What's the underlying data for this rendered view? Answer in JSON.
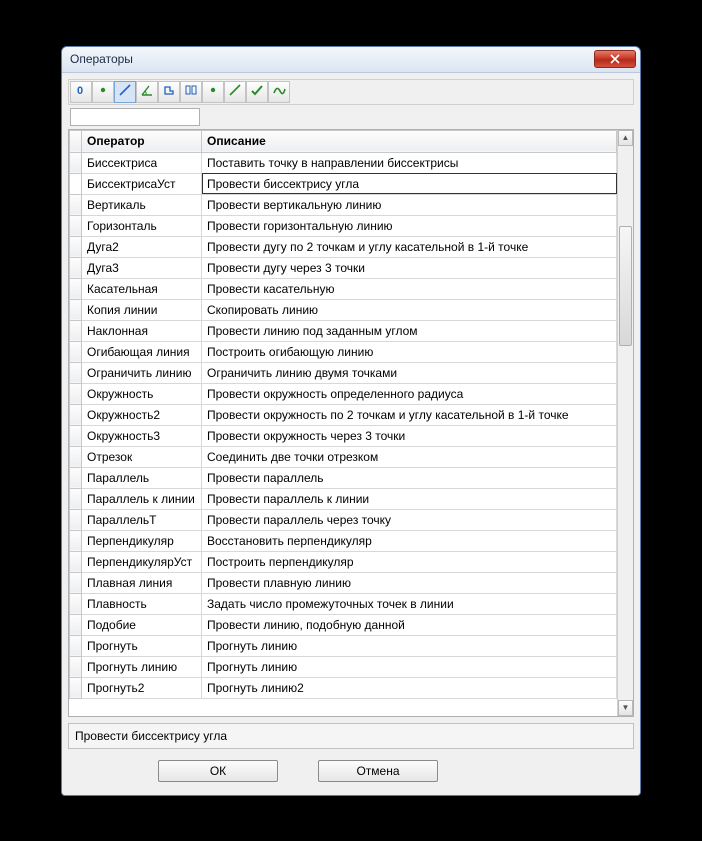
{
  "window": {
    "title": "Операторы"
  },
  "toolbar": {
    "items": [
      {
        "name": "tool-0",
        "icon": "zero"
      },
      {
        "name": "tool-dot",
        "icon": "dot"
      },
      {
        "name": "tool-line",
        "icon": "line",
        "active": true
      },
      {
        "name": "tool-angle",
        "icon": "angle"
      },
      {
        "name": "tool-poly",
        "icon": "poly"
      },
      {
        "name": "tool-align",
        "icon": "align"
      },
      {
        "name": "tool-dot2",
        "icon": "greendot"
      },
      {
        "name": "tool-line2",
        "icon": "line2"
      },
      {
        "name": "tool-check",
        "icon": "check"
      },
      {
        "name": "tool-curve",
        "icon": "curve"
      }
    ]
  },
  "search": {
    "value": ""
  },
  "columns": {
    "operator": "Оператор",
    "description": "Описание"
  },
  "rows": [
    {
      "op": "Биссектриса",
      "desc": "Поставить точку в направлении биссектрисы"
    },
    {
      "op": "БиссектрисаУст",
      "desc": "Провести биссектрису угла",
      "selected": true
    },
    {
      "op": "Вертикаль",
      "desc": "Провести вертикальную линию"
    },
    {
      "op": "Горизонталь",
      "desc": "Провести горизонтальную линию"
    },
    {
      "op": "Дуга2",
      "desc": "Провести дугу по 2 точкам и углу касательной в 1-й точке"
    },
    {
      "op": "Дуга3",
      "desc": "Провести дугу через 3 точки"
    },
    {
      "op": "Касательная",
      "desc": "Провести касательную"
    },
    {
      "op": "Копия линии",
      "desc": "Скопировать линию"
    },
    {
      "op": "Наклонная",
      "desc": "Провести линию под заданным углом"
    },
    {
      "op": "Огибающая линия",
      "desc": "Построить огибающую линию"
    },
    {
      "op": "Ограничить линию",
      "desc": "Ограничить линию двумя точками"
    },
    {
      "op": "Окружность",
      "desc": "Провести окружность определенного радиуса"
    },
    {
      "op": "Окружность2",
      "desc": "Провести окружность по 2 точкам и углу касательной в 1-й точке"
    },
    {
      "op": "Окружность3",
      "desc": "Провести окружность через 3 точки"
    },
    {
      "op": "Отрезок",
      "desc": "Соединить две точки отрезком"
    },
    {
      "op": "Параллель",
      "desc": "Провести параллель"
    },
    {
      "op": "Параллель к линии",
      "desc": "Провести параллель к линии"
    },
    {
      "op": "ПараллельТ",
      "desc": "Провести параллель через точку"
    },
    {
      "op": "Перпендикуляр",
      "desc": "Восстановить перпендикуляр"
    },
    {
      "op": "ПерпендикулярУст",
      "desc": "Построить перпендикуляр"
    },
    {
      "op": "Плавная линия",
      "desc": "Провести плавную линию"
    },
    {
      "op": "Плавность",
      "desc": "Задать число промежуточных точек в линии"
    },
    {
      "op": "Подобие",
      "desc": "Провести линию, подобную данной"
    },
    {
      "op": "Прогнуть",
      "desc": "Прогнуть линию"
    },
    {
      "op": "Прогнуть линию",
      "desc": "Прогнуть линию"
    },
    {
      "op": "Прогнуть2",
      "desc": "Прогнуть линию2"
    }
  ],
  "status": {
    "text": "Провести биссектрису угла"
  },
  "buttons": {
    "ok": "ОК",
    "cancel": "Отмена"
  }
}
